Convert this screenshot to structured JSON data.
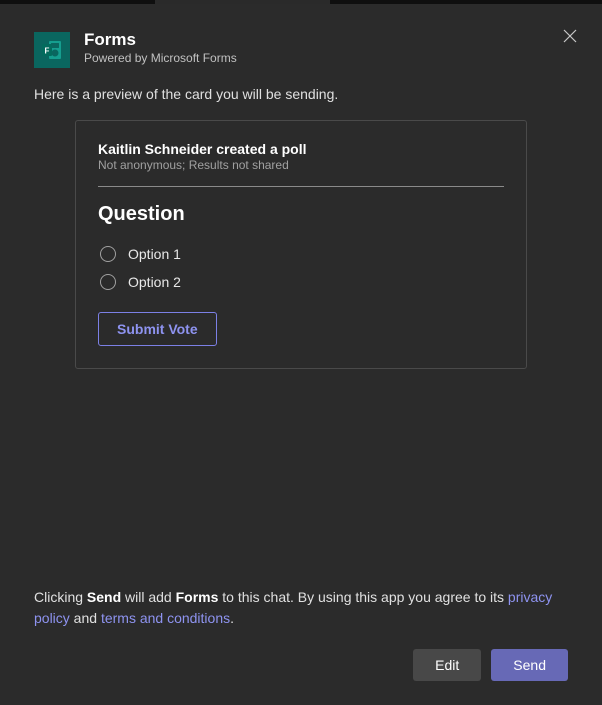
{
  "header": {
    "title": "Forms",
    "subtitle": "Powered by Microsoft Forms"
  },
  "preview_text": "Here is a preview of the card you will be sending.",
  "card": {
    "creator_line": "Kaitlin Schneider created a poll",
    "meta": "Not anonymous; Results not shared",
    "question": "Question",
    "options": [
      "Option 1",
      "Option 2"
    ],
    "submit_label": "Submit Vote"
  },
  "footer": {
    "prefix": "Clicking ",
    "bold1": "Send",
    "mid1": " will add ",
    "bold2": "Forms",
    "mid2": " to this chat. By using this app you agree to its ",
    "link1": "privacy policy",
    "and": " and ",
    "link2": "terms and conditions",
    "suffix": "."
  },
  "buttons": {
    "edit": "Edit",
    "send": "Send"
  }
}
